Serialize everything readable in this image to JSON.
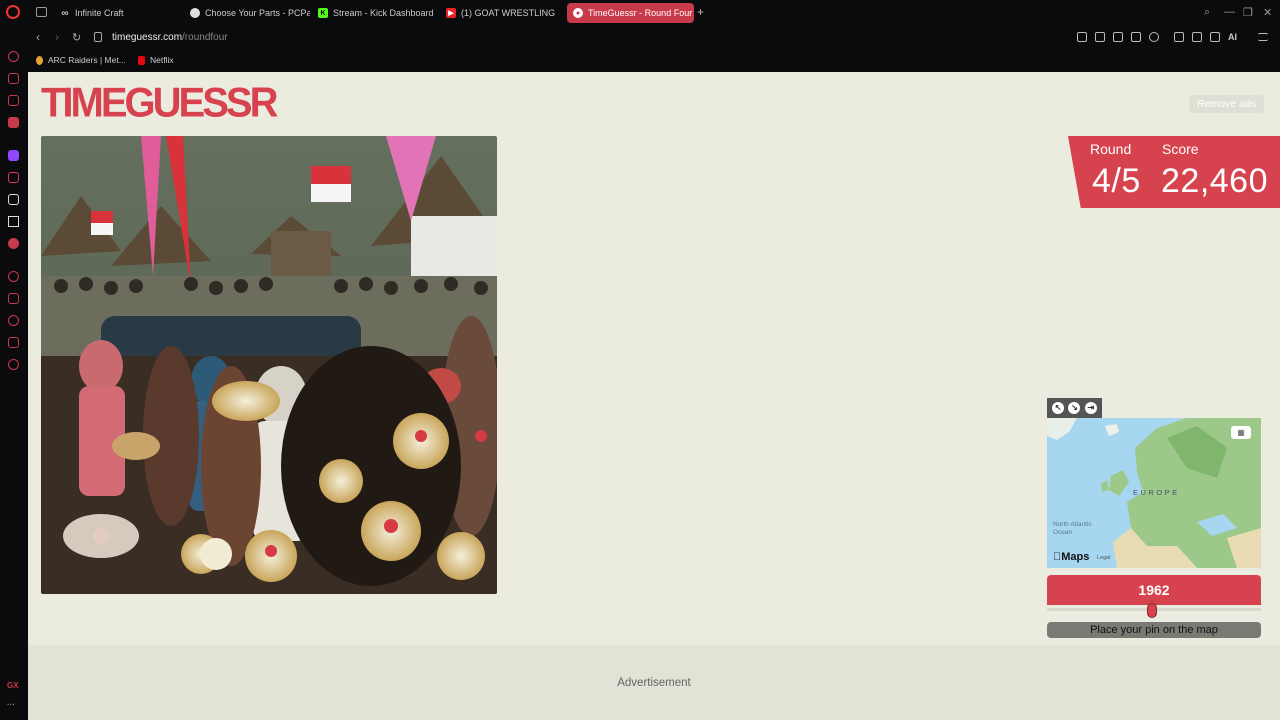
{
  "browser": {
    "tabs": [
      {
        "label": "Infinite Craft",
        "icon": "infinity-icon"
      },
      {
        "label": "Choose Your Parts - PCPa",
        "icon": "pcpartpicker-icon"
      },
      {
        "label": "Stream - Kick Dashboard",
        "icon": "kick-icon"
      },
      {
        "label": "(1) GOAT WRESTLING!!! -",
        "icon": "youtube-icon"
      },
      {
        "label": "TimeGuessr - Round Four",
        "icon": "timeguessr-icon"
      }
    ],
    "active_tab": 4,
    "url_domain": "timeguessr.com",
    "url_path": "/roundfour",
    "bookmarks": [
      {
        "label": "ARC Raiders | Met..."
      },
      {
        "label": "Netflix"
      }
    ],
    "ai_label": "AI",
    "sidebar_footer": "GX",
    "accent": "#c8394a"
  },
  "game": {
    "logo_text": "TIMEGUESSR",
    "remove_ads": "Remove ads",
    "round_label": "Round",
    "round_value": "4/5",
    "score_label": "Score",
    "score_value": "22,460",
    "map": {
      "region_label": "EUROPE",
      "ocean_label": "North Atlantic Ocean",
      "brand": "Maps",
      "legal": "Legal"
    },
    "year_value": "1962",
    "year_slider_fraction": 0.5,
    "pin_prompt": "Place your pin on the map",
    "ad_label": "Advertisement",
    "brand_color": "#d7424f"
  }
}
